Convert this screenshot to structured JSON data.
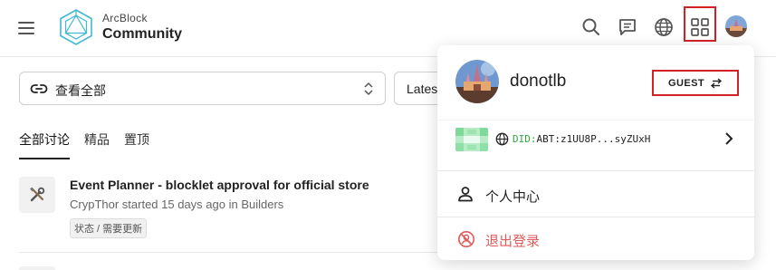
{
  "header": {
    "brand_top": "ArcBlock",
    "brand_main": "Community",
    "icons": [
      "menu-icon",
      "search-icon",
      "chat-icon",
      "globe-icon",
      "apps-grid-icon"
    ]
  },
  "filters": {
    "category_label": "查看全部",
    "sort_label": "Lates"
  },
  "tabs": [
    {
      "label": "全部讨论",
      "active": true
    },
    {
      "label": "精品",
      "active": false
    },
    {
      "label": "置顶",
      "active": false
    }
  ],
  "post": {
    "title": "Event Planner - blocklet approval for official store",
    "meta": "CrypThor started 15 days ago in Builders",
    "tag": "状态 / 需要更新"
  },
  "user_menu": {
    "username": "donotlb",
    "role": "GUEST",
    "did_prefix": "DID:",
    "did_value": "ABT:z1UU8P...syZUxH",
    "profile_label": "个人中心",
    "logout_label": "退出登录"
  },
  "colors": {
    "highlight": "#d32027",
    "logo": "#3fb7d6",
    "did_prefix": "#2faa3f",
    "logout": "#e05a5a"
  }
}
